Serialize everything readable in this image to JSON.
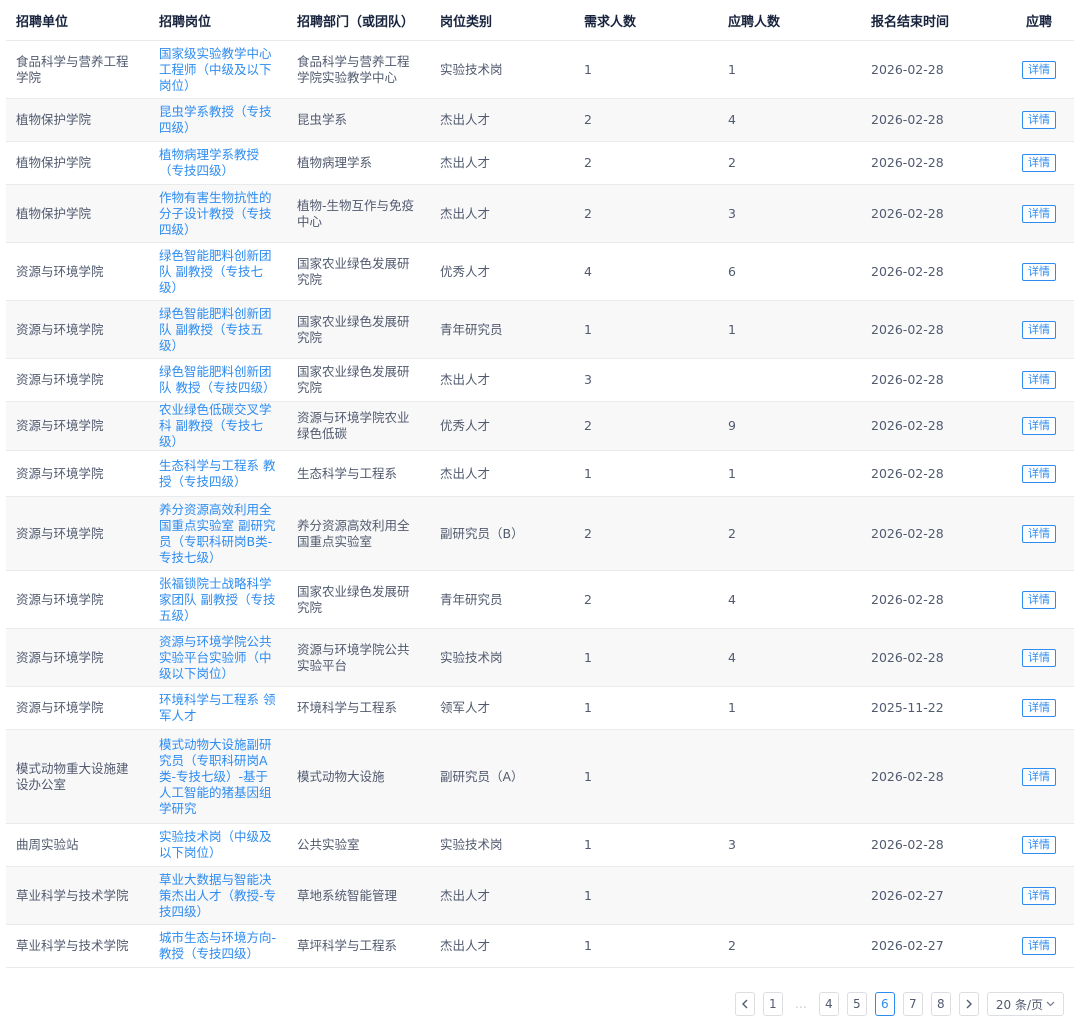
{
  "table": {
    "headers": [
      "招聘单位",
      "招聘岗位",
      "招聘部门（或团队）",
      "岗位类别",
      "需求人数",
      "应聘人数",
      "报名结束时间",
      "应聘"
    ],
    "detail_label": "详情",
    "rows": [
      {
        "unit": "食品科学与营养工程学院",
        "post": "国家级实验教学中心工程师（中级及以下岗位）",
        "dept": "食品科学与营养工程学院实验教学中心",
        "category": "实验技术岗",
        "need": "1",
        "applicants": "1",
        "deadline": "2026-02-28"
      },
      {
        "unit": "植物保护学院",
        "post": "昆虫学系教授（专技四级）",
        "dept": "昆虫学系",
        "category": "杰出人才",
        "need": "2",
        "applicants": "4",
        "deadline": "2026-02-28"
      },
      {
        "unit": "植物保护学院",
        "post": "植物病理学系教授（专技四级）",
        "dept": "植物病理学系",
        "category": "杰出人才",
        "need": "2",
        "applicants": "2",
        "deadline": "2026-02-28"
      },
      {
        "unit": "植物保护学院",
        "post": "作物有害生物抗性的分子设计教授（专技四级）",
        "dept": "植物-生物互作与免疫中心",
        "category": "杰出人才",
        "need": "2",
        "applicants": "3",
        "deadline": "2026-02-28"
      },
      {
        "unit": "资源与环境学院",
        "post": "绿色智能肥料创新团队 副教授（专技七级）",
        "dept": "国家农业绿色发展研究院",
        "category": "优秀人才",
        "need": "4",
        "applicants": "6",
        "deadline": "2026-02-28"
      },
      {
        "unit": "资源与环境学院",
        "post": "绿色智能肥料创新团队 副教授（专技五级）",
        "dept": "国家农业绿色发展研究院",
        "category": "青年研究员",
        "need": "1",
        "applicants": "1",
        "deadline": "2026-02-28"
      },
      {
        "unit": "资源与环境学院",
        "post": "绿色智能肥料创新团队 教授（专技四级）",
        "dept": "国家农业绿色发展研究院",
        "category": "杰出人才",
        "need": "3",
        "applicants": "",
        "deadline": "2026-02-28"
      },
      {
        "unit": "资源与环境学院",
        "post": "农业绿色低碳交叉学科 副教授（专技七级）",
        "dept": "资源与环境学院农业绿色低碳",
        "category": "优秀人才",
        "need": "2",
        "applicants": "9",
        "deadline": "2026-02-28"
      },
      {
        "unit": "资源与环境学院",
        "post": "生态科学与工程系 教授（专技四级）",
        "dept": "生态科学与工程系",
        "category": "杰出人才",
        "need": "1",
        "applicants": "1",
        "deadline": "2026-02-28"
      },
      {
        "unit": "资源与环境学院",
        "post": "养分资源高效利用全国重点实验室 副研究员（专职科研岗B类-专技七级）",
        "dept": "养分资源高效利用全国重点实验室",
        "category": "副研究员（B）",
        "need": "2",
        "applicants": "2",
        "deadline": "2026-02-28"
      },
      {
        "unit": "资源与环境学院",
        "post": "张福锁院士战略科学家团队 副教授（专技五级）",
        "dept": "国家农业绿色发展研究院",
        "category": "青年研究员",
        "need": "2",
        "applicants": "4",
        "deadline": "2026-02-28"
      },
      {
        "unit": "资源与环境学院",
        "post": "资源与环境学院公共实验平台实验师（中级以下岗位）",
        "dept": "资源与环境学院公共实验平台",
        "category": "实验技术岗",
        "need": "1",
        "applicants": "4",
        "deadline": "2026-02-28"
      },
      {
        "unit": "资源与环境学院",
        "post": "环境科学与工程系 领军人才",
        "dept": "环境科学与工程系",
        "category": "领军人才",
        "need": "1",
        "applicants": "1",
        "deadline": "2025-11-22"
      },
      {
        "unit": "模式动物重大设施建设办公室",
        "post": "模式动物大设施副研究员（专职科研岗A类-专技七级）-基于人工智能的猪基因组学研究",
        "dept": "模式动物大设施",
        "category": "副研究员（A）",
        "need": "1",
        "applicants": "",
        "deadline": "2026-02-28"
      },
      {
        "unit": "曲周实验站",
        "post": "实验技术岗（中级及以下岗位）",
        "dept": "公共实验室",
        "category": "实验技术岗",
        "need": "1",
        "applicants": "3",
        "deadline": "2026-02-28"
      },
      {
        "unit": "草业科学与技术学院",
        "post": "草业大数据与智能决策杰出人才（教授-专技四级）",
        "dept": "草地系统智能管理",
        "category": "杰出人才",
        "need": "1",
        "applicants": "",
        "deadline": "2026-02-27"
      },
      {
        "unit": "草业科学与技术学院",
        "post": "城市生态与环境方向-教授（专技四级）",
        "dept": "草坪科学与工程系",
        "category": "杰出人才",
        "need": "1",
        "applicants": "2",
        "deadline": "2026-02-27"
      }
    ]
  },
  "pagination": {
    "prev_icon": "chevron-left-icon",
    "next_icon": "chevron-right-icon",
    "pages": [
      "1",
      "…",
      "4",
      "5",
      "6",
      "7",
      "8"
    ],
    "current": "6",
    "page_size": "20 条/页",
    "active_color": "#2d8cf0"
  }
}
